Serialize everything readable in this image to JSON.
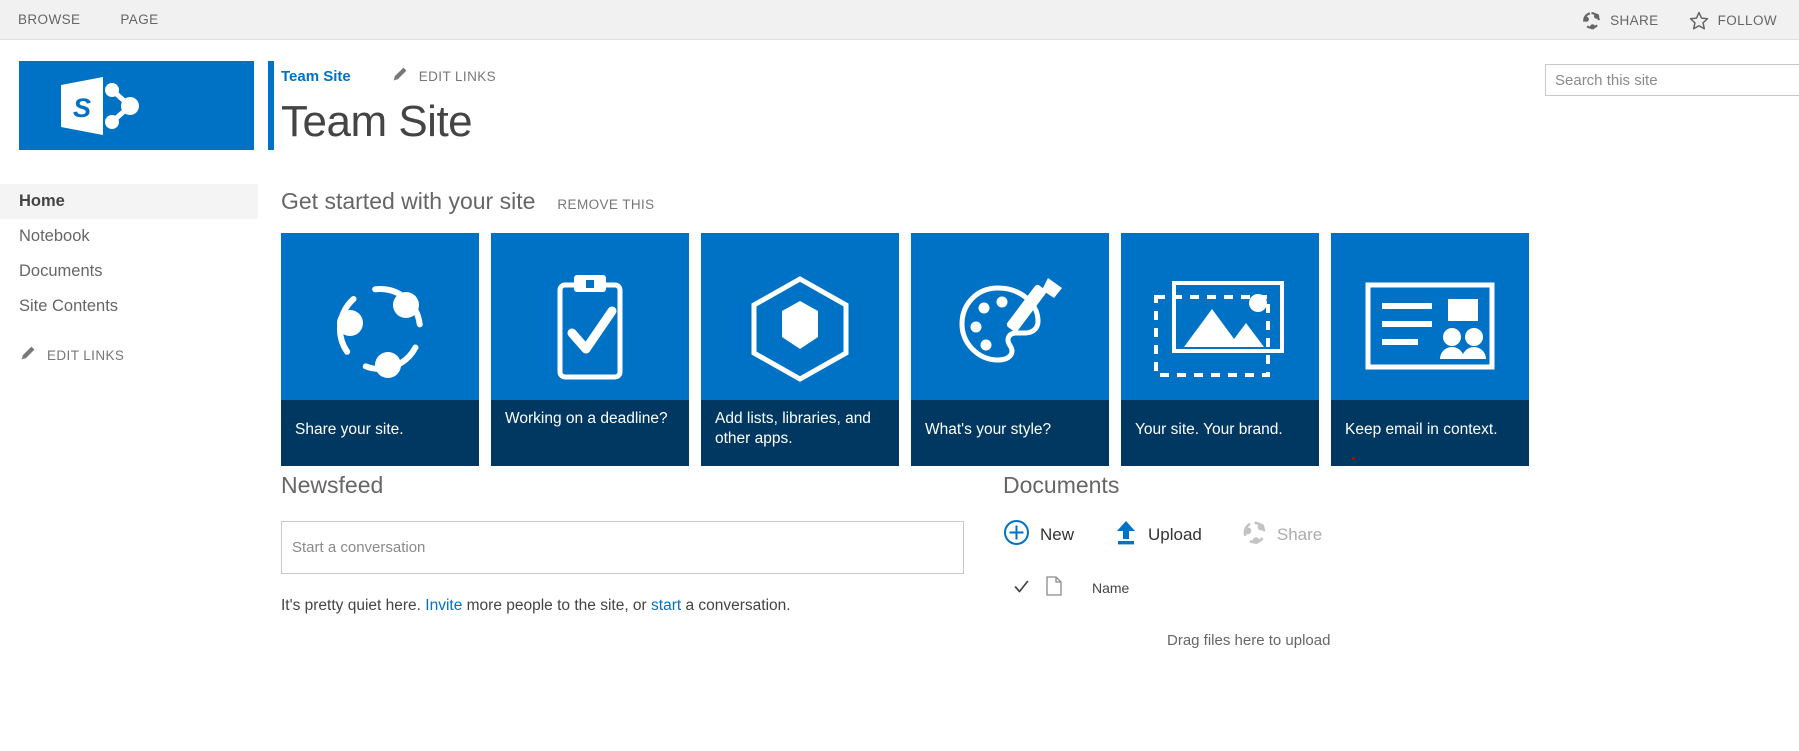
{
  "suitebar": {
    "ribbon_tabs": [
      {
        "label": "BROWSE",
        "name": "ribbon-tab-browse"
      },
      {
        "label": "PAGE",
        "name": "ribbon-tab-page"
      }
    ],
    "share_label": "SHARE",
    "share_icon": "share-icon",
    "follow_label": "FOLLOW",
    "follow_icon": "star-icon"
  },
  "logo": {
    "letter": "S",
    "icon": "sharepoint-logo-icon",
    "color": "#0072c6"
  },
  "sidebar": {
    "items": [
      {
        "label": "Home",
        "selected": true
      },
      {
        "label": "Notebook",
        "selected": false
      },
      {
        "label": "Documents",
        "selected": false
      },
      {
        "label": "Site Contents",
        "selected": false
      }
    ],
    "edit_links_label": "EDIT LINKS",
    "edit_links_icon": "pencil-icon"
  },
  "header": {
    "site_nav_label": "Team Site",
    "edit_links_label": "EDIT LINKS",
    "edit_links_icon": "pencil-icon",
    "page_title": "Team Site"
  },
  "search": {
    "placeholder": "Search this site",
    "value": ""
  },
  "get_started": {
    "title": "Get started with your site",
    "remove_label": "REMOVE THIS",
    "tiles": [
      {
        "caption": "Share your site.",
        "icon": "share-nodes-icon"
      },
      {
        "caption": "Working on a deadline?",
        "icon": "clipboard-check-icon"
      },
      {
        "caption": "Add lists, libraries, and other apps.",
        "icon": "hexagon-cube-icon"
      },
      {
        "caption": "What's your style?",
        "icon": "paint-palette-icon"
      },
      {
        "caption": "Your site. Your brand.",
        "icon": "picture-frame-icon"
      },
      {
        "caption": "Keep email in context.",
        "icon": "email-card-icon"
      }
    ]
  },
  "newsfeed": {
    "title": "Newsfeed",
    "conversation_placeholder": "Start a conversation",
    "conversation_value": "",
    "quiet_prefix": "It's pretty quiet here. ",
    "quiet_link_invite": "Invite",
    "quiet_middle": " more people to the site, or ",
    "quiet_link_start": "start",
    "quiet_suffix": " a conversation."
  },
  "documents": {
    "title": "Documents",
    "commands": [
      {
        "label": "New",
        "icon": "plus-circle-icon",
        "disabled": false
      },
      {
        "label": "Upload",
        "icon": "upload-arrow-icon",
        "disabled": false
      },
      {
        "label": "Share",
        "icon": "share-icon",
        "disabled": true
      }
    ],
    "column_header_name": "Name",
    "check_icon": "checkmark-icon",
    "doc_icon": "document-icon",
    "drag_hint": "Drag files here to upload"
  }
}
